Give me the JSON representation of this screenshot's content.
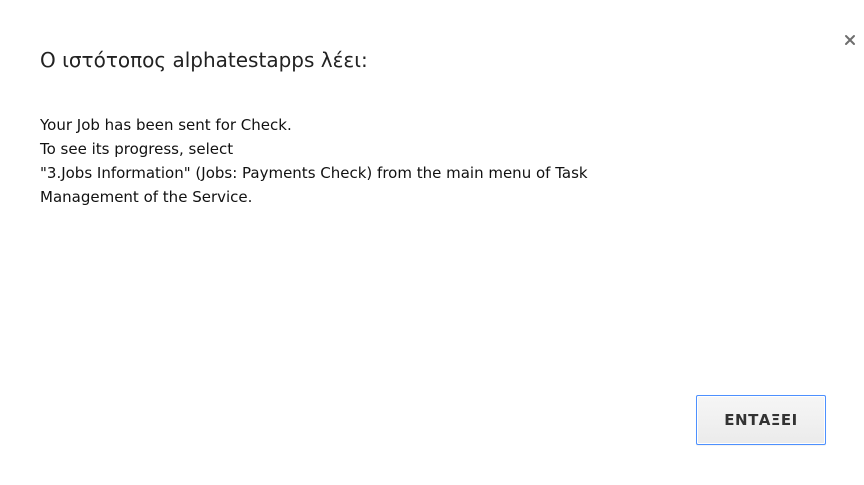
{
  "dialog": {
    "title": "Ο ιστότοπος alphatestapps λέει:",
    "close_icon": "close-icon",
    "message_lines": [
      "Your Job has been sent for Check.",
      "To see its progress, select",
      "\"3.Jobs Information\" (Jobs: Payments Check) from the main menu of Task",
      "Management of the Service."
    ],
    "ok_label": "ΕΝΤΑΞΕΙ"
  },
  "colors": {
    "background": "#ffffff",
    "button_border": "#4d90fe",
    "text": "#111111"
  }
}
